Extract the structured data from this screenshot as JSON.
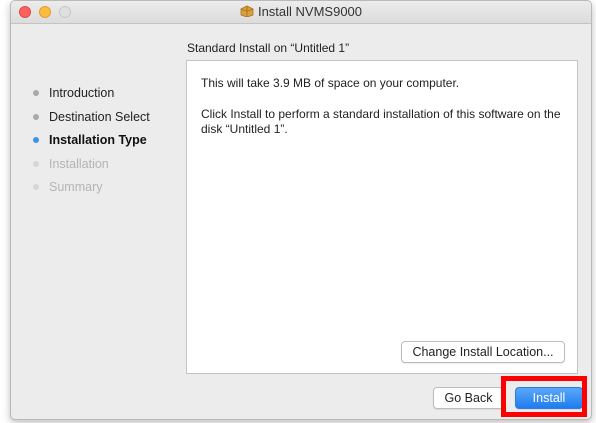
{
  "window": {
    "title": "Install NVMS9000"
  },
  "page": {
    "subtitle": "Standard Install on “Untitled 1”"
  },
  "steps": [
    {
      "label": "Introduction",
      "state": "done"
    },
    {
      "label": "Destination Select",
      "state": "done"
    },
    {
      "label": "Installation Type",
      "state": "active"
    },
    {
      "label": "Installation",
      "state": "pending"
    },
    {
      "label": "Summary",
      "state": "pending"
    }
  ],
  "content": {
    "line1": "This will take 3.9 MB of space on your computer.",
    "line2": "Click Install to perform a standard installation of this software on the disk “Untitled 1”.",
    "change_location_label": "Change Install Location..."
  },
  "buttons": {
    "go_back": "Go Back",
    "install": "Install"
  },
  "colors": {
    "accent": "#3e94e6",
    "install_button": "#1e7cf0",
    "highlight": "#ff0000"
  },
  "icons": {
    "title": "package-icon"
  }
}
